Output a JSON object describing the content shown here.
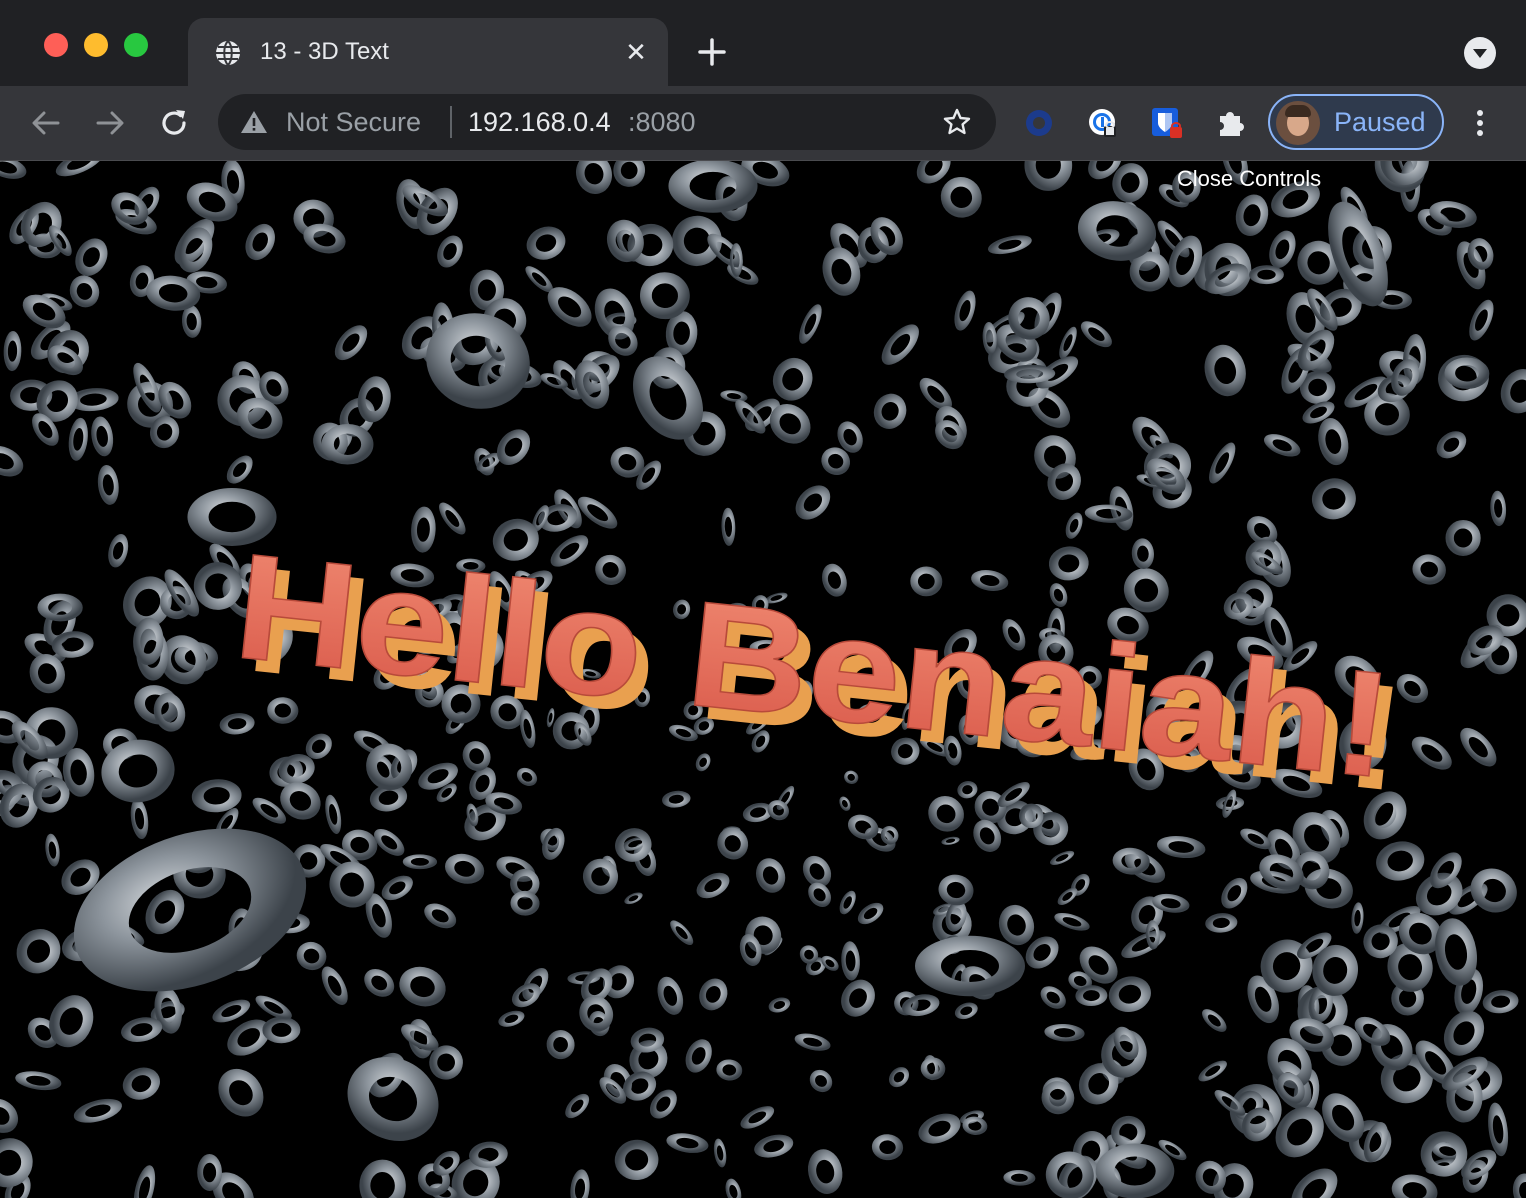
{
  "browser": {
    "tab": {
      "title": "13 - 3D Text",
      "favicon": "globe-icon",
      "close": "✕"
    },
    "omnibox": {
      "security_label": "Not Secure",
      "url_host": "192.168.0.4",
      "url_port": ":8080"
    },
    "profile": {
      "label": "Paused"
    },
    "extensions": [
      "ring-extension-icon",
      "lock-circle-extension-icon",
      "bitwarden-extension-icon",
      "puzzle-extensions-icon"
    ]
  },
  "scene": {
    "controls_label": "Close Controls",
    "text3d": "Hello Benaiah!",
    "text_color": "#e8735f",
    "text_side_color": "#e9a04f",
    "donut_color": "#8a9199",
    "background": "#000000"
  }
}
